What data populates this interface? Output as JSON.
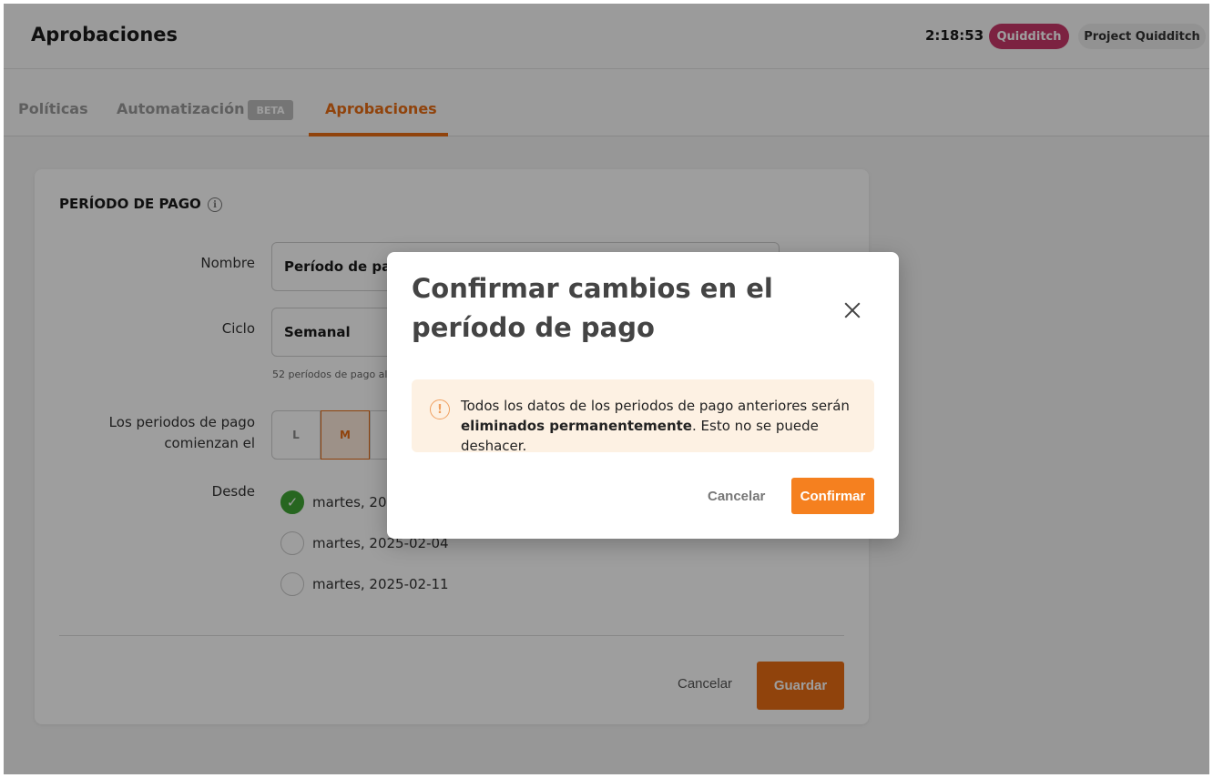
{
  "header": {
    "title": "Aprobaciones",
    "clock": "2:18:53",
    "team": "Quidditch",
    "project": "Project Quidditch"
  },
  "tabs": [
    {
      "label": "Políticas"
    },
    {
      "label": "Automatización",
      "badge": "BETA"
    },
    {
      "label": "Aprobaciones",
      "active": true
    }
  ],
  "card": {
    "title": "PERÍODO DE PAGO",
    "name_label": "Nombre",
    "name_value": "Período de pago",
    "cycle_label": "Ciclo",
    "cycle_value": "Semanal",
    "cycle_hint": "52 períodos de pago al",
    "start_label_1": "Los periodos de pago",
    "start_label_2": "comienzan el",
    "days": [
      "L",
      "M"
    ],
    "selected_day": "M",
    "from_label": "Desde",
    "options": [
      "martes, 202",
      "martes, 2025-02-04",
      "martes, 2025-02-11"
    ],
    "cancel": "Cancelar",
    "save": "Guardar"
  },
  "modal": {
    "title": "Confirmar cambios en el período de pago",
    "alert_pre": "Todos los datos de los periodos de pago anteriores serán ",
    "alert_bold": "eliminados permanentemente",
    "alert_post": ". Esto no se puede deshacer.",
    "cancel": "Cancelar",
    "confirm": "Confirmar"
  },
  "colors": {
    "accent": "#e86d14",
    "team_pill": "#c8386a",
    "success": "#3fa535",
    "alert_bg": "#fdf1e3"
  }
}
